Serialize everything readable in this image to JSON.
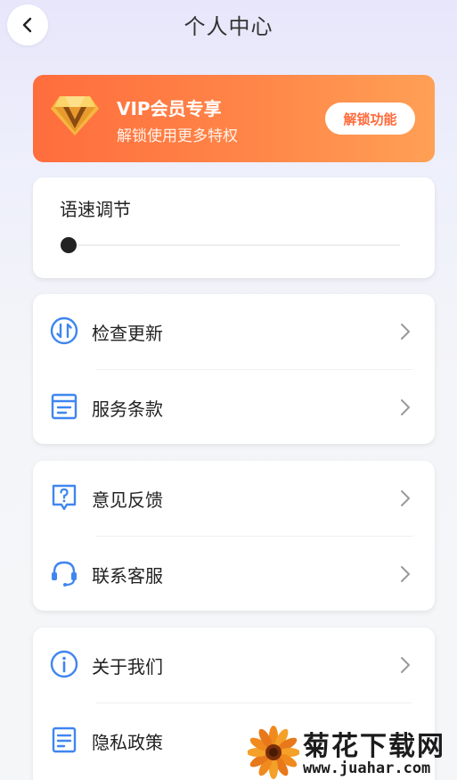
{
  "header": {
    "title": "个人中心",
    "back_icon": "chevron-left-icon"
  },
  "vip": {
    "title": "VIP会员专享",
    "subtitle": "解锁使用更多特权",
    "button_label": "解锁功能",
    "icon": "vip-diamond-icon",
    "gradient_colors": [
      "#ff6d3d",
      "#ffa055"
    ]
  },
  "speed": {
    "label": "语速调节",
    "value_fraction": 0.0
  },
  "menu_groups": [
    {
      "items": [
        {
          "label": "检查更新",
          "icon": "update-icon"
        },
        {
          "label": "服务条款",
          "icon": "document-icon"
        }
      ]
    },
    {
      "items": [
        {
          "label": "意见反馈",
          "icon": "feedback-icon"
        },
        {
          "label": "联系客服",
          "icon": "headset-icon"
        }
      ]
    },
    {
      "items": [
        {
          "label": "关于我们",
          "icon": "info-icon"
        },
        {
          "label": "隐私政策",
          "icon": "document-icon"
        }
      ]
    }
  ],
  "colors": {
    "icon_blue": "#3f86f0",
    "vip_orange": "#ff6a3a"
  },
  "watermark": {
    "title": "菊花下载网",
    "url": "www.juahar.com"
  }
}
